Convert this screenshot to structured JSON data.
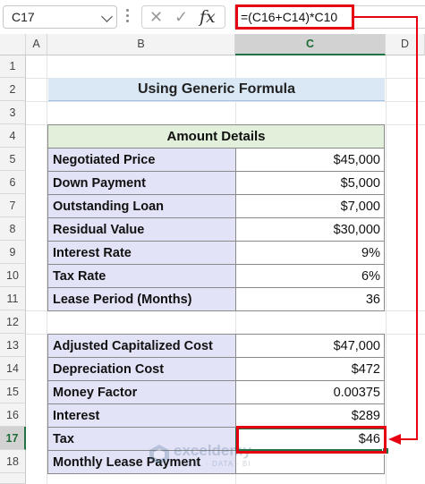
{
  "formula_bar": {
    "name_box": "C17",
    "formula": "=(C16+C14)*C10",
    "fx_label": "fx",
    "cancel_icon": "x-icon",
    "enter_icon": "check-icon"
  },
  "columns": [
    "A",
    "B",
    "C",
    "D"
  ],
  "rows": [
    "1",
    "2",
    "3",
    "4",
    "5",
    "6",
    "7",
    "8",
    "9",
    "10",
    "11",
    "12",
    "13",
    "14",
    "15",
    "16",
    "17",
    "18"
  ],
  "title": "Using Generic Formula",
  "amount_details": {
    "header": "Amount Details",
    "items": [
      {
        "label": "Negotiated Price",
        "value": "$45,000"
      },
      {
        "label": "Down Payment",
        "value": "$5,000"
      },
      {
        "label": "Outstanding Loan",
        "value": "$7,000"
      },
      {
        "label": "Residual Value",
        "value": "$30,000"
      },
      {
        "label": "Interest Rate",
        "value": "9%"
      },
      {
        "label": "Tax Rate",
        "value": "6%"
      },
      {
        "label": "Lease Period (Months)",
        "value": "36"
      }
    ]
  },
  "calculations": {
    "items": [
      {
        "label": "Adjusted Capitalized Cost",
        "value": "$47,000"
      },
      {
        "label": "Depreciation Cost",
        "value": "$472"
      },
      {
        "label": "Money Factor",
        "value": "0.00375"
      },
      {
        "label": "Interest",
        "value": "$289"
      },
      {
        "label": "Tax",
        "value": "$46"
      },
      {
        "label": "Monthly Lease Payment",
        "value": ""
      }
    ]
  },
  "watermark": {
    "name": "exceldemy",
    "tagline": "EXCEL · DATA · BI"
  },
  "colors": {
    "highlight_red": "#e60012",
    "selection_green": "#217346",
    "title_fill": "#dae8f5",
    "header_fill": "#e2efda",
    "label_fill": "#e3e3f8"
  }
}
